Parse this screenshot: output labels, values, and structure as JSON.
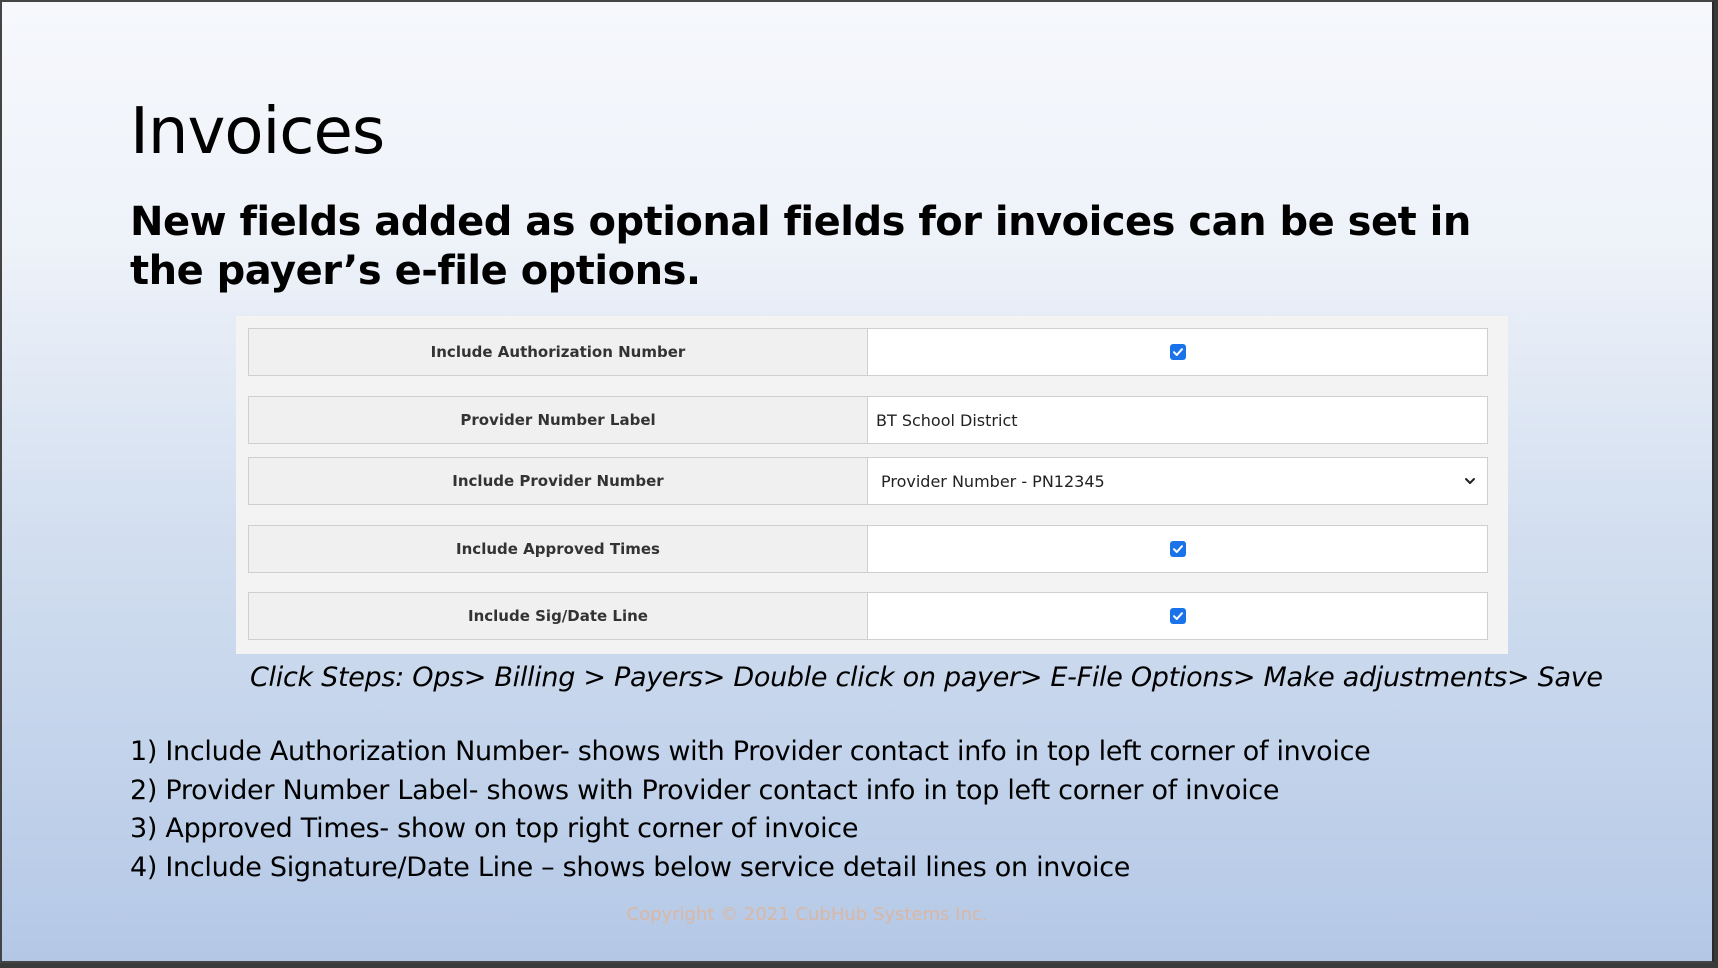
{
  "slide": {
    "title": "Invoices",
    "subtitle": "New fields added as optional fields for invoices can be set in the payer’s e-file options."
  },
  "form": {
    "rows": [
      {
        "label": "Include Authorization Number",
        "type": "checkbox",
        "checked": true
      },
      {
        "label": "Provider Number Label",
        "type": "text",
        "value": "BT School District"
      },
      {
        "label": "Include Provider Number",
        "type": "select",
        "value": "Provider Number - PN12345"
      },
      {
        "label": "Include Approved Times",
        "type": "checkbox",
        "checked": true
      },
      {
        "label": "Include Sig/Date Line",
        "type": "checkbox",
        "checked": true
      }
    ]
  },
  "click_steps": "Click Steps: Ops> Billing > Payers> Double click on payer> E-File Options> Make adjustments> Save",
  "notes": [
    "1) Include Authorization Number- shows with Provider contact info in top left corner of invoice",
    "2) Provider Number Label- shows with Provider contact info in top left corner of invoice",
    "3) Approved Times- show on top right corner of invoice",
    "4) Include Signature/Date Line – shows below service detail lines on invoice"
  ],
  "copyright": "Copyright © 2021 CubHub Systems Inc.",
  "colors": {
    "checkbox_accent": "#1a73e8",
    "copyright_text": "#d8b8a4"
  },
  "icons": {
    "checkbox": "checkmark-icon",
    "select": "chevron-down-icon"
  }
}
